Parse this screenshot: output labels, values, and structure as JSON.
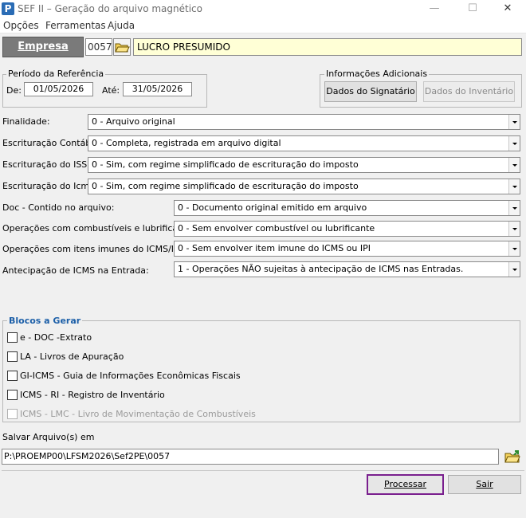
{
  "window": {
    "title": "SEF II – Geração do arquivo magnético",
    "icon_letter": "P"
  },
  "menu": [
    "Opções",
    "Ferramentas",
    "Ajuda"
  ],
  "empresa": {
    "button_label": "Empresa",
    "code": "0057",
    "name": "LUCRO PRESUMIDO"
  },
  "periodo": {
    "legend": "Período da Referência",
    "de_label": "De:",
    "de_value": "01/05/2026",
    "ate_label": "Até:",
    "ate_value": "31/05/2026"
  },
  "info_adicionais": {
    "legend": "Informações Adicionais",
    "signatario": "Dados do Signatário",
    "inventario": "Dados do Inventário"
  },
  "fields": [
    {
      "label": "Finalidade:",
      "value": "0 - Arquivo original"
    },
    {
      "label": "Escrituração Contábil:",
      "value": "0 - Completa, registrada em arquivo digital"
    },
    {
      "label": "Escrituração do ISS:",
      "value": "0 - Sim, com regime simplificado de escrituração do imposto"
    },
    {
      "label": "Escrituração do Icms:",
      "value": "0 - Sim, com regime simplificado de escrituração do imposto"
    },
    {
      "label": "Doc - Contido no arquivo:",
      "value": "0 - Documento original emitido em arquivo"
    },
    {
      "label": "Operações com combustíveis e lubrificantes:",
      "value": "0 - Sem envolver combustível ou lubrificante"
    },
    {
      "label": "Operações com itens imunes do ICMS/IPI:",
      "value": "0 - Sem envolver item imune do ICMS ou IPI"
    },
    {
      "label": "Antecipação de ICMS na Entrada:",
      "value": "1 - Operações NÃO sujeitas à antecipação de ICMS nas Entradas."
    }
  ],
  "blocos": {
    "legend": "Blocos a Gerar",
    "items": [
      {
        "label": "e - DOC  -Extrato",
        "checked": false,
        "enabled": true
      },
      {
        "label": "LA - Livros de Apuração",
        "checked": false,
        "enabled": true
      },
      {
        "label": "GI-ICMS - Guia de Informações Econômicas Fiscais",
        "checked": false,
        "enabled": true
      },
      {
        "label": "ICMS - RI - Registro de Inventário",
        "checked": false,
        "enabled": true
      },
      {
        "label": "ICMS - LMC - Livro de Movimentação de Combustíveis",
        "checked": false,
        "enabled": false
      }
    ]
  },
  "salvar": {
    "label": "Salvar Arquivo(s) em",
    "path": "P:\\PROEMP00\\LFSM2026\\Sef2PE\\0057"
  },
  "actions": {
    "processar": "Processar",
    "sair": "Sair"
  },
  "colors": {
    "processar_border": "#7a1f8e",
    "blocos_legend": "#1c5fa8",
    "empresa_name_bg": "#ffffd6"
  }
}
